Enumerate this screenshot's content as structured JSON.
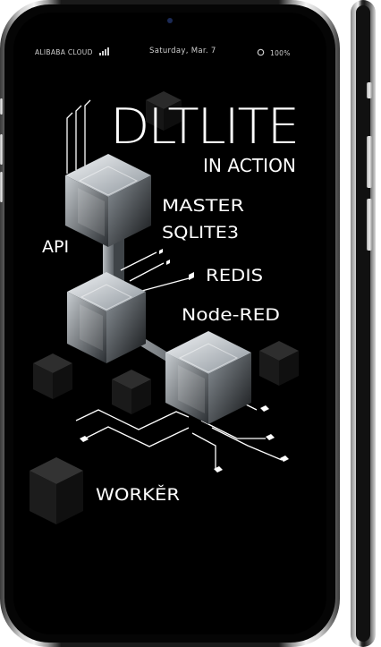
{
  "status_bar": {
    "carrier": "ALIBABA CLOUD",
    "date": "Saturday, Mar. 7",
    "battery": "100%",
    "signal_icon": "signal-bars-icon",
    "battery_icon": "circle-icon"
  },
  "screen": {
    "title": "DLTLITE",
    "subtitle": "IN ACTION",
    "labels": {
      "master": "MASTER",
      "sqlite": "SQLITE3",
      "api": "API",
      "redis": "REDIS",
      "nodered": "Node-RED",
      "worker": "WORKĚR"
    }
  },
  "colors": {
    "screen_bg": "#000000",
    "text": "#ffffff",
    "cube_light": "#dfe3e6",
    "cube_dark": "#1e1e1e"
  }
}
